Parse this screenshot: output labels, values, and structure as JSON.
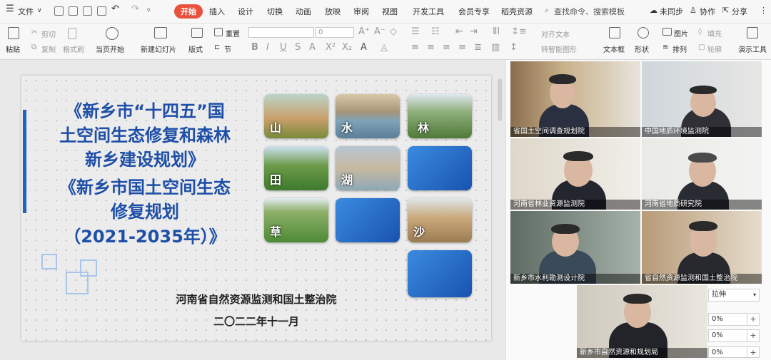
{
  "menubar": {
    "file": "文件",
    "tabs": [
      "开始",
      "插入",
      "设计",
      "切换",
      "动画",
      "放映",
      "审阅",
      "视图",
      "开发工具",
      "会员专享",
      "稻壳资源"
    ],
    "search": "查找命令、搜索模板",
    "sync": "未同步",
    "collab": "协作",
    "share": "分享"
  },
  "ribbon": {
    "paste": "粘贴",
    "cut": "剪切",
    "copy": "复制",
    "format_painter": "格式刷",
    "from_current": "当页开始",
    "new_slide": "新建幻灯片",
    "layout": "版式",
    "section": "节",
    "reset": "重置",
    "font_size": "0",
    "align_text": "对齐文本",
    "smart_graphic": "转智能图形",
    "textbox": "文本框",
    "shape": "形状",
    "picture": "图片",
    "fill": "填充",
    "arrange": "排列",
    "outline": "轮廓",
    "present_tool": "演示工具"
  },
  "slide": {
    "title_lines": [
      "《新乡市“十四五”国",
      "土空间生态修复和森林",
      "新乡建设规划》",
      "《新乡市国土空间生态",
      "修复规划",
      "（2021-2035年）》"
    ],
    "org": "河南省自然资源监测和国土整治院",
    "date": "二〇二二年十一月",
    "tiles": [
      "山",
      "水",
      "林",
      "田",
      "湖",
      "草",
      "沙"
    ]
  },
  "video": {
    "participants": [
      "省国土空间调查规划院",
      "中国地质环境监测院",
      "河南省林业资源监测院",
      "河南省地质研究院",
      "新乡市水利勘测设计院",
      "省自然资源监测和国土整治院",
      "新乡市自然资源和规划局"
    ]
  },
  "props": {
    "stretch": "拉伸",
    "v1": "0%",
    "v2": "0%",
    "v3": "0%"
  }
}
